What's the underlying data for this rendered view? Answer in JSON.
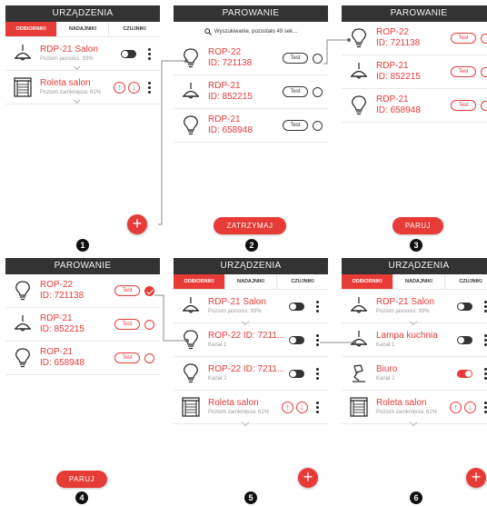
{
  "colors": {
    "accent": "#e63b37",
    "header_bg": "#333333",
    "text_dark": "#222222",
    "subtext": "#999999"
  },
  "screen1": {
    "title": "URZĄDZENIA",
    "tabs": [
      "ODBIORNIKI",
      "NADAJNIKI",
      "CZUJNIKI"
    ],
    "rows": [
      {
        "name": "RDP-21 Salon",
        "sub": "Poziom jasności: 93%",
        "icon": "ceiling-lamp-icon"
      },
      {
        "name": "Roleta salon",
        "sub": "Poziom zamknięcia: 61%",
        "icon": "blind-icon"
      }
    ]
  },
  "screen2": {
    "title": "PAROWANIE",
    "search": "Wyszukiwanie, pozostało 49 sek...",
    "rows": [
      {
        "l1": "ROP-22",
        "l2": "ID: 721138",
        "icon": "bulb-icon",
        "test": "Test"
      },
      {
        "l1": "RDP-21",
        "l2": "ID: 852215",
        "icon": "ceiling-lamp-icon",
        "test": "Test"
      },
      {
        "l1": "RDP-21",
        "l2": "ID: 658948",
        "icon": "bulb-icon",
        "test": "Test"
      }
    ],
    "button": "ZATRZYMAJ"
  },
  "screen3": {
    "title": "PAROWANIE",
    "rows": [
      {
        "l1": "ROP-22",
        "l2": "ID: 721138",
        "icon": "bulb-icon",
        "test": "Test"
      },
      {
        "l1": "RDP-21",
        "l2": "ID: 852215",
        "icon": "ceiling-lamp-icon",
        "test": "Test"
      },
      {
        "l1": "RDP-21",
        "l2": "ID: 658948",
        "icon": "bulb-icon",
        "test": "Test"
      }
    ],
    "button": "PARUJ"
  },
  "screen4": {
    "title": "PAROWANIE",
    "rows": [
      {
        "l1": "ROP-22",
        "l2": "ID: 721138",
        "icon": "bulb-icon",
        "test": "Test",
        "checked": true
      },
      {
        "l1": "RDP-21",
        "l2": "ID: 852215",
        "icon": "ceiling-lamp-icon",
        "test": "Test"
      },
      {
        "l1": "ROP-21",
        "l2": "ID: 658948",
        "icon": "bulb-icon",
        "test": "Test"
      }
    ],
    "button": "PARUJ"
  },
  "screen5": {
    "title": "URZĄDZENIA",
    "tabs": [
      "ODBIORNIKI",
      "NADAJNIKI",
      "CZUJNIKI"
    ],
    "rows": [
      {
        "name": "RDP-21 Salon",
        "sub": "Poziom jasności: 93%",
        "icon": "ceiling-lamp-icon"
      },
      {
        "name": "ROP-22 ID: 7211...",
        "sub": "Kanał 1",
        "icon": "bulb-icon"
      },
      {
        "name": "ROP-22 ID: 7211...",
        "sub": "Kanał 2",
        "icon": "bulb-icon"
      },
      {
        "name": "Roleta salon",
        "sub": "Poziom zamknięcia: 61%",
        "icon": "blind-icon"
      }
    ]
  },
  "screen6": {
    "title": "URZĄDZENIA",
    "tabs": [
      "ODBIORNIKI",
      "NADAJNIKI",
      "CZUJNIKI"
    ],
    "rows": [
      {
        "name": "RDP-21 Salon",
        "sub": "Poziom jasności: 93%",
        "icon": "ceiling-lamp-icon"
      },
      {
        "name": "Lampa kuchnia",
        "sub": "Kanał 1",
        "icon": "ceiling-lamp-icon"
      },
      {
        "name": "Biuro",
        "sub": "Kanał 2",
        "icon": "desk-lamp-icon"
      },
      {
        "name": "Roleta salon",
        "sub": "Poziom zamknięcia: 61%",
        "icon": "blind-icon"
      }
    ]
  },
  "steps": [
    "1",
    "2",
    "3",
    "4",
    "5",
    "6"
  ],
  "icons": {
    "up": "↑",
    "down": "↓",
    "plus": "+"
  }
}
